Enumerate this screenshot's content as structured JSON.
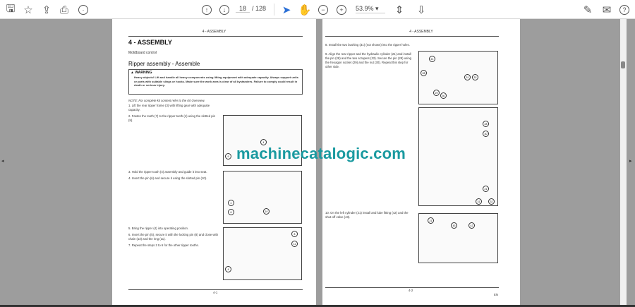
{
  "toolbar": {
    "page_current": "18",
    "page_total": "/ 128",
    "zoom": "53.9%",
    "icons": [
      "save-icon",
      "star-icon",
      "upload-icon",
      "print-icon",
      "zoom-search-icon",
      "page-up-icon",
      "page-down-icon",
      "select-cursor-icon",
      "hand-icon",
      "zoom-out-icon",
      "zoom-in-icon",
      "fit-page-icon",
      "scroll-mode-icon",
      "sign-icon",
      "mail-icon",
      "account-icon"
    ]
  },
  "watermark": "machinecatalogic.com",
  "left_page": {
    "header": "4 - ASSEMBLY",
    "title": "4 - ASSEMBLY",
    "subtitle": "Moldboard control",
    "section": "Ripper assembly - Assemble",
    "warning_label": "WARNING",
    "warning_text": "Heavy objects! Lift and handle all heavy components using lifting equipment with adequate capacity. Always support units or parts with suitable slings or hooks. Make sure the work area is clear of all bystanders. Failure to comply could result in death or serious injury.",
    "note": "NOTE: For complete kit content refer to the Kit Overview.",
    "steps": [
      "1.  Lift the rear ripper frame (3) with lifting gear with adequate capacity.",
      "2.  Fasten the tooth (7) to the ripper tooth (4) using the slotted pin (9).",
      "3.  Hold the ripper tooth (4) assembly and guide it into seat.",
      "4.  Insert the pin (6) and secure it using the slotted pin (10).",
      "5.  Bring the ripper (4) into operating position.",
      "6.  Insert the pin (5), secure it with the locking pin (8) and close with chain (13) and the ring (11).",
      "7.  Repeat the steps 2 to 6 for the other ripper tooths."
    ],
    "footer": "4-1"
  },
  "right_page": {
    "header": "4 - ASSEMBLY",
    "steps": [
      "8.  Install the two bushing (31) (not shown) into the ripper holes.",
      "9.  Align the rear ripper and the hydraulic cylinder (21) and install the pin (28) and the two scrapers (32). Secure the pin (28) using the hexagon socket (29) and the nut (30). Repeat this step for other side.",
      "10.  On the left cylinder (21) install and lube fitting (42) and the shut-off valve (43)."
    ],
    "callouts_fig1": [
      "21",
      "28",
      "31",
      "32",
      "29",
      "30"
    ],
    "callouts_fig2": [
      "28",
      "30",
      "21",
      "31",
      "32"
    ],
    "callouts_fig3": [
      "21",
      "43",
      "42"
    ],
    "footer": "4-2",
    "lang": "EN"
  }
}
